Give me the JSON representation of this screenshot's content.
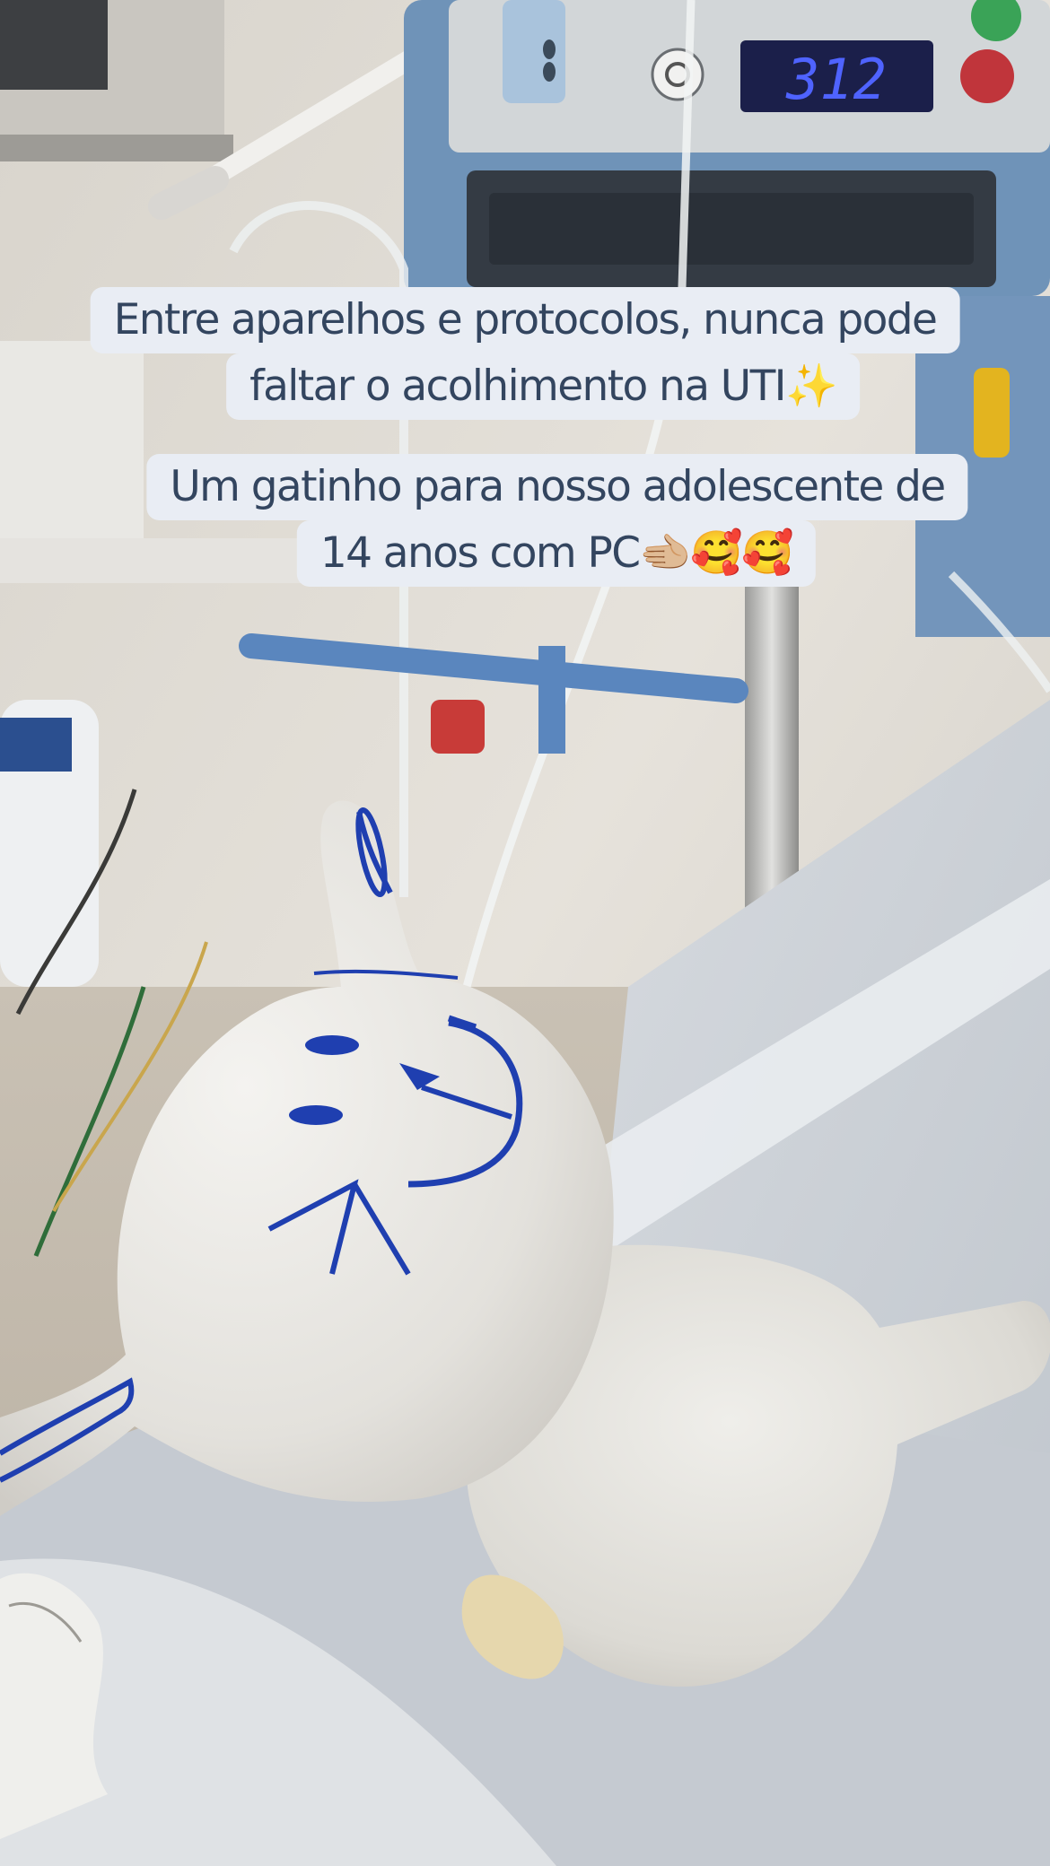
{
  "story": {
    "caption_lines": [
      "Entre aparelhos e protocolos, nunca pode",
      "faltar o acolhimento  na UTI✨",
      "Um gatinho para nosso adolescente de",
      "14 anos com PC🫲🏼🥰🥰"
    ],
    "pump_display": "312",
    "colors": {
      "caption_bg": "#e9edf4",
      "caption_text": "#33455f",
      "pump_blue": "#6f93b8",
      "ink_blue": "#1f3fb0"
    }
  },
  "icons": [
    "sparkles-icon",
    "pointing-hand-icon",
    "smiling-face-with-hearts-icon"
  ]
}
